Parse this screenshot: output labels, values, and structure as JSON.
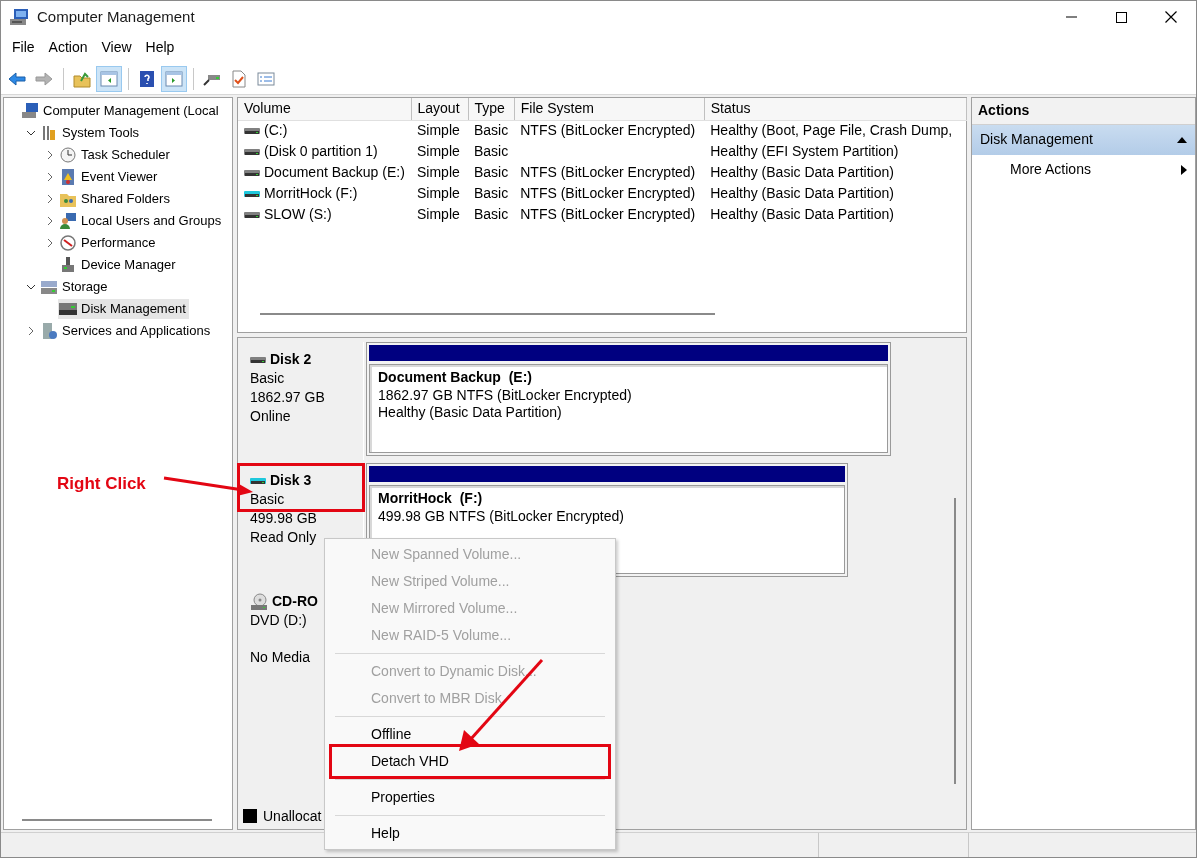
{
  "window": {
    "title": "Computer Management"
  },
  "menu": [
    {
      "label": "File"
    },
    {
      "label": "Action"
    },
    {
      "label": "View"
    },
    {
      "label": "Help"
    }
  ],
  "toolbar": [
    [
      {
        "pressed": false,
        "disabled": false
      },
      {
        "pressed": false,
        "disabled": true
      }
    ],
    [
      {
        "pressed": false,
        "disabled": false
      },
      {
        "pressed": true,
        "disabled": false
      }
    ],
    [
      {
        "pressed": false,
        "disabled": false
      },
      {
        "pressed": true,
        "disabled": false
      }
    ],
    [
      {
        "pressed": false,
        "disabled": false
      },
      {
        "pressed": false,
        "disabled": false
      },
      {
        "pressed": false,
        "disabled": false
      }
    ]
  ],
  "tree": [
    {
      "label": "Computer Management (Local",
      "selected": false,
      "children": [
        {
          "label": "System Tools",
          "expanded": true,
          "selected": false,
          "children": [
            {
              "label": "Task Scheduler",
              "expanded": false,
              "selected": false
            },
            {
              "label": "Event Viewer",
              "expanded": false,
              "selected": false
            },
            {
              "label": "Shared Folders",
              "expanded": false,
              "selected": false
            },
            {
              "label": "Local Users and Groups",
              "expanded": false,
              "selected": false
            },
            {
              "label": "Performance",
              "expanded": false,
              "selected": false
            },
            {
              "label": "Device Manager",
              "selected": false
            }
          ]
        },
        {
          "label": "Storage",
          "expanded": true,
          "selected": false,
          "children": [
            {
              "label": "Disk Management",
              "selected": true
            }
          ]
        },
        {
          "label": "Services and Applications",
          "expanded": false,
          "selected": false
        }
      ]
    }
  ],
  "volume_table": {
    "columns": [
      "Volume",
      "Layout",
      "Type",
      "File System",
      "Status"
    ],
    "rows": [
      {
        "volume": "(C:)",
        "layout": "Simple",
        "type": "Basic",
        "file_system": "NTFS (BitLocker Encrypted)",
        "status": "Healthy (Boot, Page File, Crash Dump,",
        "color": "#808080"
      },
      {
        "volume": "(Disk 0 partition 1)",
        "layout": "Simple",
        "type": "Basic",
        "status": "Healthy (EFI System Partition)",
        "color": "#808080"
      },
      {
        "volume": "Document Backup (E:)",
        "layout": "Simple",
        "type": "Basic",
        "file_system": "NTFS (BitLocker Encrypted)",
        "status": "Healthy (Basic Data Partition)",
        "color": "#808080"
      },
      {
        "volume": "MorritHock (F:)",
        "layout": "Simple",
        "type": "Basic",
        "file_system": "NTFS (BitLocker Encrypted)",
        "status": "Healthy (Basic Data Partition)",
        "color": "#1ec8dc"
      },
      {
        "volume": "SLOW (S:)",
        "layout": "Simple",
        "type": "Basic",
        "file_system": "NTFS (BitLocker Encrypted)",
        "status": "Healthy (Basic Data Partition)",
        "color": "#808080"
      }
    ]
  },
  "disks": [
    {
      "kind": "disk",
      "name": "Disk 2",
      "color": "#808080",
      "lines": [
        "Basic",
        "1862.97 GB",
        "Online"
      ],
      "partitions": [
        {
          "name": "Document Backup  (E:)",
          "lines": [
            "1862.97 GB NTFS (BitLocker Encrypted)",
            "Healthy (Basic Data Partition)"
          ]
        }
      ]
    },
    {
      "kind": "disk",
      "name": "Disk 3",
      "color": "#1ec8dc",
      "lines": [
        "Basic",
        "499.98 GB",
        "Read Only"
      ],
      "partitions": [
        {
          "name": "MorritHock  (F:)",
          "lines": [
            "499.98 GB NTFS (BitLocker Encrypted)"
          ]
        }
      ]
    },
    {
      "kind": "cdrom",
      "name": "CD-RO",
      "lines": [
        "DVD (D:)",
        "No Media"
      ]
    }
  ],
  "legend": [
    {
      "label": "Unallocat",
      "color": "#000000"
    }
  ],
  "context_menu": [
    [
      {
        "label": "New Spanned Volume...",
        "disabled": true
      },
      {
        "label": "New Striped Volume...",
        "disabled": true
      },
      {
        "label": "New Mirrored Volume...",
        "disabled": true
      },
      {
        "label": "New RAID-5 Volume...",
        "disabled": true
      }
    ],
    [
      {
        "label": "Convert to Dynamic Disk...",
        "disabled": true
      },
      {
        "label": "Convert to MBR Disk",
        "disabled": true
      }
    ],
    [
      {
        "label": "Offline",
        "disabled": false
      },
      {
        "label": "Detach VHD",
        "disabled": false
      }
    ],
    [
      {
        "label": "Properties",
        "disabled": false
      }
    ],
    [
      {
        "label": "Help",
        "disabled": false
      }
    ]
  ],
  "actions": {
    "title": "Actions",
    "section": {
      "label": "Disk Management",
      "expanded": true
    },
    "items": [
      {
        "label": "More Actions"
      }
    ]
  },
  "annotation": {
    "label": "Right Click"
  }
}
